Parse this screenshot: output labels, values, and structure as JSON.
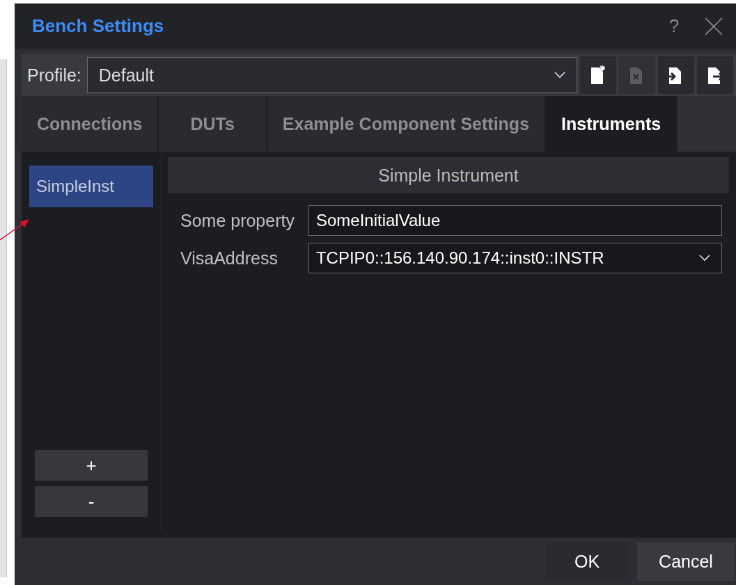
{
  "window": {
    "title": "Bench Settings",
    "help": "?"
  },
  "profile": {
    "label": "Profile:",
    "value": "Default"
  },
  "profile_tools": [
    {
      "kind": "new",
      "disabled": false
    },
    {
      "kind": "delete",
      "disabled": true
    },
    {
      "kind": "import",
      "disabled": false
    },
    {
      "kind": "export",
      "disabled": false
    }
  ],
  "tabs": [
    {
      "label": "Connections",
      "selected": false
    },
    {
      "label": "DUTs",
      "selected": false
    },
    {
      "label": "Example Component Settings",
      "selected": false
    },
    {
      "label": "Instruments",
      "selected": true
    }
  ],
  "instruments": [
    {
      "label": "SimpleInst",
      "selected": true
    }
  ],
  "list_buttons": [
    "+",
    "-"
  ],
  "panel": {
    "title": "Simple Instrument",
    "properties": [
      {
        "kind": "text",
        "label": "Some property",
        "value": "SomeInitialValue"
      },
      {
        "kind": "dropdown",
        "label": "VisaAddress",
        "value": "TCPIP0::156.140.90.174::inst0::INSTR"
      }
    ]
  },
  "buttons": [
    "OK",
    "Cancel"
  ]
}
